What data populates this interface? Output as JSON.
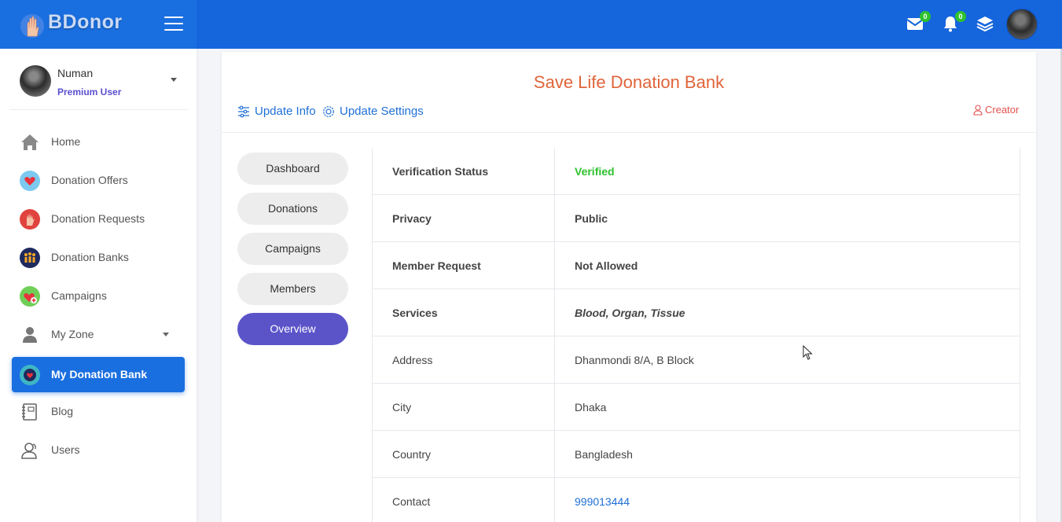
{
  "brand": {
    "name": "BDonor"
  },
  "topbar": {
    "messages_count": "0",
    "notifications_count": "0",
    "icons": [
      "envelope-icon",
      "bell-icon",
      "layers-icon"
    ],
    "color": "#1565dd"
  },
  "user": {
    "name": "Numan",
    "role": "Premium User"
  },
  "sidebar": {
    "items": [
      {
        "label": "Home",
        "icon": "home-icon"
      },
      {
        "label": "Donation Offers",
        "icon": "heart-hand-icon"
      },
      {
        "label": "Donation Requests",
        "icon": "raised-hand-icon"
      },
      {
        "label": "Donation Banks",
        "icon": "people-group-icon"
      },
      {
        "label": "Campaigns",
        "icon": "campaign-heart-icon"
      },
      {
        "label": "My Zone",
        "icon": "person-icon"
      },
      {
        "label": "My Donation Bank",
        "icon": "bank-badge-icon",
        "active": true
      },
      {
        "label": "Blog",
        "icon": "notebook-icon"
      },
      {
        "label": "Users",
        "icon": "users-icon"
      }
    ],
    "active_color": "#1a6fe0"
  },
  "bank": {
    "title": "Save Life Donation Bank",
    "update_info": "Update Info",
    "update_settings": "Update Settings",
    "creator": "Creator"
  },
  "tabs": [
    {
      "label": "Dashboard"
    },
    {
      "label": "Donations"
    },
    {
      "label": "Campaigns"
    },
    {
      "label": "Members"
    },
    {
      "label": "Overview",
      "active": true
    }
  ],
  "overview": {
    "rows": [
      {
        "key": "Verification Status",
        "value": "Verified"
      },
      {
        "key": "Privacy",
        "value": "Public"
      },
      {
        "key": "Member Request",
        "value": "Not Allowed"
      },
      {
        "key": "Services",
        "value": "Blood, Organ, Tissue"
      },
      {
        "key": "Address",
        "value": "Dhanmondi 8/A, B Block"
      },
      {
        "key": "City",
        "value": "Dhaka"
      },
      {
        "key": "Country",
        "value": "Bangladesh"
      },
      {
        "key": "Contact",
        "value": "999013444"
      }
    ]
  },
  "colors": {
    "verified": "#2ec22e",
    "title": "#e0643a",
    "link": "#1f6fd6",
    "tab_active": "#5b54c9"
  }
}
